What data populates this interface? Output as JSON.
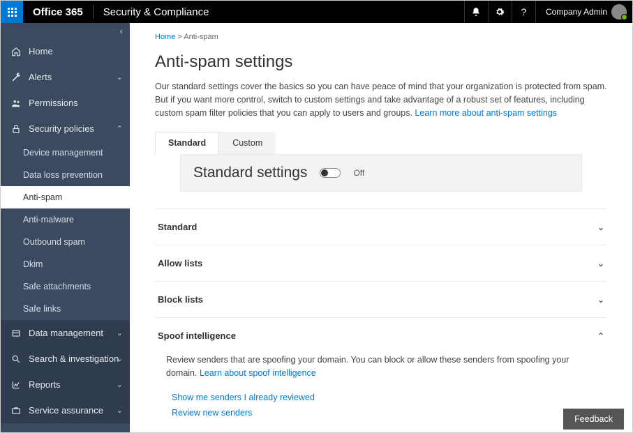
{
  "topbar": {
    "brand": "Office 365",
    "app_title": "Security & Compliance",
    "user_name": "Company Admin"
  },
  "sidebar": {
    "items": [
      {
        "icon": "home-icon",
        "label": "Home"
      },
      {
        "icon": "wrench-icon",
        "label": "Alerts",
        "caret": true
      },
      {
        "icon": "people-icon",
        "label": "Permissions"
      },
      {
        "icon": "lock-icon",
        "label": "Security policies",
        "caret_up": true,
        "expanded": true,
        "children": [
          {
            "label": "Device management"
          },
          {
            "label": "Data loss prevention"
          },
          {
            "label": "Anti-spam",
            "active": true
          },
          {
            "label": "Anti-malware"
          },
          {
            "label": "Outbound spam"
          },
          {
            "label": "Dkim"
          },
          {
            "label": "Safe attachments"
          },
          {
            "label": "Safe links"
          }
        ]
      }
    ],
    "dark_items": [
      {
        "icon": "db-icon",
        "label": "Data management",
        "caret": true
      },
      {
        "icon": "search-icon",
        "label": "Search & investigation",
        "caret": true
      },
      {
        "icon": "chart-icon",
        "label": "Reports",
        "caret": true
      },
      {
        "icon": "service-icon",
        "label": "Service assurance",
        "caret": true
      }
    ]
  },
  "breadcrumb": {
    "home": "Home",
    "sep": ">",
    "current": "Anti-spam"
  },
  "page": {
    "title": "Anti-spam settings",
    "desc": "Our standard settings cover the basics so you can have peace of mind that your organization is protected from spam. But if you want more control, switch to custom settings and take advantage of a robust set of features, including custom spam filter policies that you can apply to users and groups. ",
    "desc_link": "Learn more about anti-spam settings"
  },
  "tabs": {
    "standard": "Standard",
    "custom": "Custom"
  },
  "band": {
    "title": "Standard settings",
    "toggle_state": "Off"
  },
  "accordion": {
    "standard": "Standard",
    "allow": "Allow lists",
    "block": "Block lists",
    "spoof": {
      "title": "Spoof intelligence",
      "desc": "Review senders that are spoofing your domain. You can block or allow these senders from spoofing your domain. ",
      "learn_link": "Learn about spoof intelligence",
      "link1": "Show me senders I already reviewed",
      "link2": "Review new senders"
    }
  },
  "feedback": "Feedback"
}
